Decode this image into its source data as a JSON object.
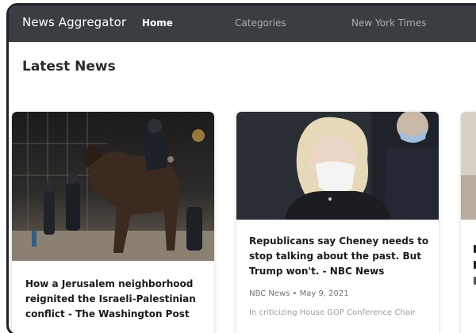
{
  "navbar": {
    "brand": "News Aggregator",
    "links": [
      "Home",
      "Categories",
      "New York Times"
    ]
  },
  "heading": "Latest News",
  "colors": {
    "navbar_bg": "#3a3d42",
    "frame_border": "#1f2124"
  },
  "articles": [
    {
      "title": "How a Jerusalem neighborhood reignited the Israeli-Palestinian conflict - The Washington Post",
      "image": "police-on-horseback-photo"
    },
    {
      "title": "Republicans say Cheney needs to stop talking about the past. But Trump won't. - NBC News",
      "meta": "NBC News • May 9, 2021",
      "description": "In criticizing House GOP Conference Chair",
      "image": "woman-with-mask-photo"
    },
    {
      "title_fragment": "",
      "image": "partial-photo"
    }
  ]
}
